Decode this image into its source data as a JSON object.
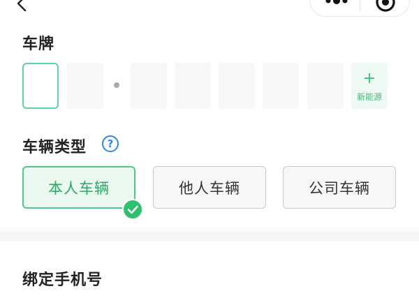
{
  "topbar": {
    "back_icon": "chevron-left-icon",
    "more_icon": "more-dots-icon",
    "close_icon": "target-close-icon"
  },
  "plate": {
    "label": "车牌",
    "slots": [
      "",
      "",
      "",
      "",
      "",
      "",
      ""
    ],
    "new_energy_plus": "+",
    "new_energy_label": "新能源"
  },
  "vehicle_type": {
    "label": "车辆类型",
    "help_symbol": "?",
    "options": [
      "本人车辆",
      "他人车辆",
      "公司车辆"
    ],
    "selected": "本人车辆"
  },
  "bind_phone": {
    "label": "绑定手机号"
  },
  "colors": {
    "accent": "#2fbf6e",
    "accent_border": "#52c789",
    "accent_bg": "#eaf8f0",
    "help_blue": "#2f86e0"
  }
}
